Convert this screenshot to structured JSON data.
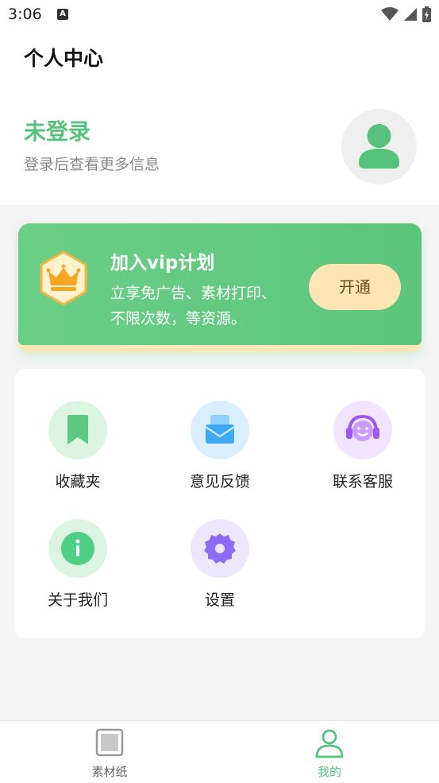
{
  "status_bar": {
    "time": "3:06",
    "notification_letter": "A"
  },
  "header": {
    "title": "个人中心"
  },
  "profile": {
    "login_title": "未登录",
    "login_subtitle": "登录后查看更多信息"
  },
  "vip": {
    "title": "加入vip计划",
    "desc_line1": "立享免广告、素材打印、",
    "desc_line2": "不限次数，等资源。",
    "button_label": "开通"
  },
  "menu": {
    "favorites": "收藏夹",
    "feedback": "意见反馈",
    "support": "联系客服",
    "about": "关于我们",
    "settings": "设置"
  },
  "tabbar": {
    "materials": "素材纸",
    "mine": "我的",
    "active_color": "#57c27c",
    "inactive_color": "#666666"
  }
}
